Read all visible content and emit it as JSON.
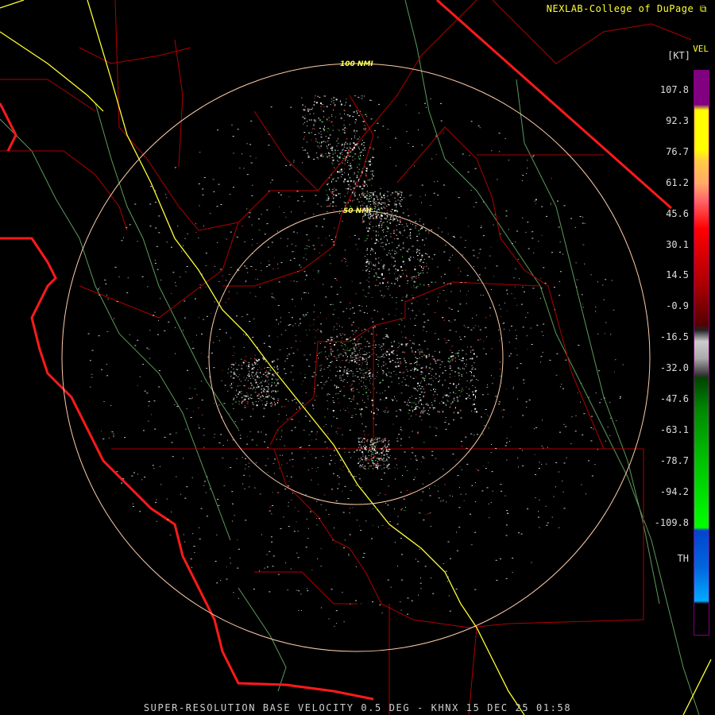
{
  "header": {
    "credit": "NEXLAB-College of DuPage",
    "product": "VEL",
    "units": "[KT]"
  },
  "footer": {
    "caption": "SUPER-RESOLUTION BASE VELOCITY 0.5 DEG - KHNX 15 DEC 25 01:58"
  },
  "rings": [
    {
      "label": "100 NMI"
    },
    {
      "label": "50 NMI"
    }
  ],
  "colorbar": {
    "ticks": [
      "107.8",
      "92.3",
      "76.7",
      "61.2",
      "45.6",
      "30.1",
      "14.5",
      "-0.9",
      "-16.5",
      "-32.0",
      "-47.6",
      "-63.1",
      "-78.7",
      "-94.2",
      "-109.8",
      "TH"
    ],
    "colors": {
      "top": "#800080",
      "yellow": "#ffff00",
      "orange": "#ffaa66",
      "red": "#ff0000",
      "darkred": "#550000",
      "gray": "#aaaaaa",
      "darkgreen": "#004400",
      "green": "#00ff00",
      "blue": "#0044cc",
      "cyan": "#00aaff",
      "th": "#000000"
    }
  },
  "map_colors": {
    "county_lines": "#b00000",
    "state_lines": "#ff2020",
    "highway": "#ffff33",
    "rivers": "#66aa66",
    "range_rings": "#ffccaa"
  }
}
